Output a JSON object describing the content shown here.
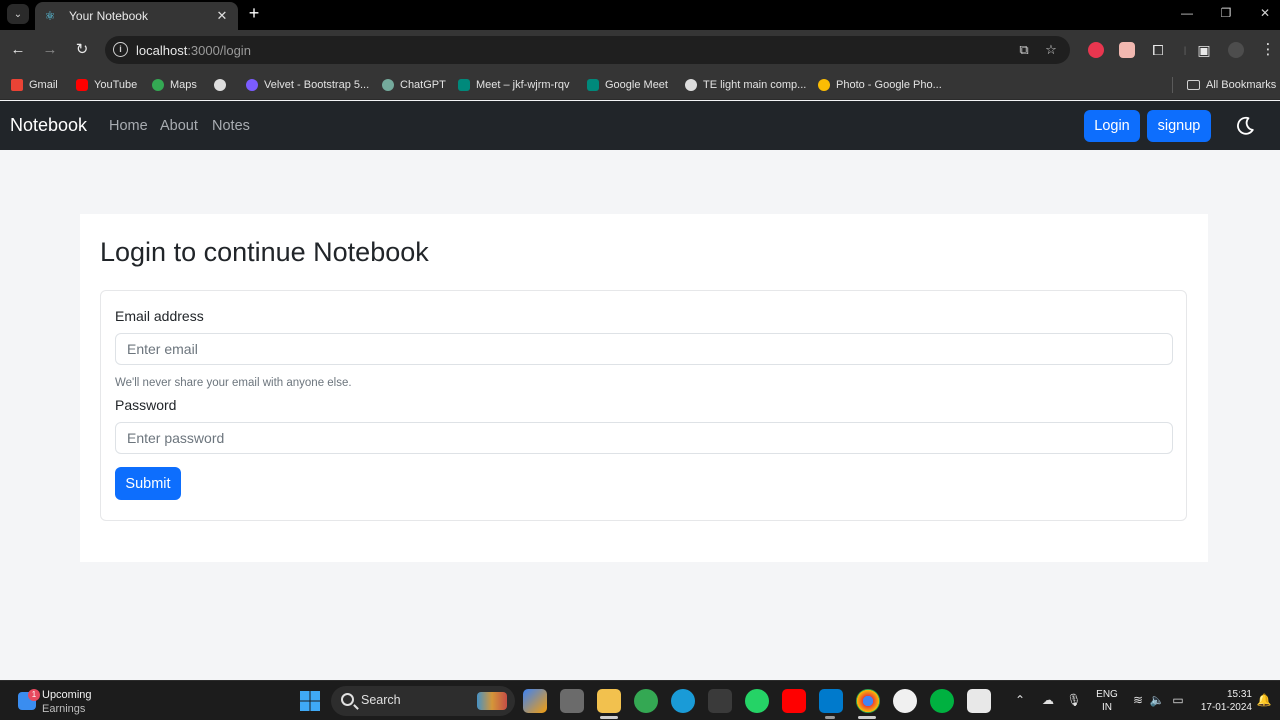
{
  "browser": {
    "tab": {
      "title": "Your Notebook",
      "favicon": "react-icon"
    },
    "url": {
      "host": "localhost",
      "path": ":3000/login"
    },
    "bookmarks": [
      {
        "label": "Gmail",
        "icon": "gmail-icon",
        "color": "#ea4335"
      },
      {
        "label": "YouTube",
        "icon": "youtube-icon",
        "color": "#ff0000"
      },
      {
        "label": "Maps",
        "icon": "maps-icon",
        "color": "#34a853"
      },
      {
        "label": "",
        "icon": "globe-icon",
        "color": "#dddddd"
      },
      {
        "label": "Velvet - Bootstrap 5...",
        "icon": "velvet-icon",
        "color": "#7b5cff"
      },
      {
        "label": "ChatGPT",
        "icon": "chatgpt-icon",
        "color": "#74aa9c"
      },
      {
        "label": "Meet – jkf-wjrm-rqv",
        "icon": "meet-icon",
        "color": "#00897b"
      },
      {
        "label": "Google Meet",
        "icon": "meet-icon",
        "color": "#00897b"
      },
      {
        "label": "TE light main comp...",
        "icon": "globe-icon",
        "color": "#dddddd"
      },
      {
        "label": "Photo - Google Pho...",
        "icon": "photos-icon",
        "color": "#fbbc04"
      }
    ],
    "all_bookmarks": "All Bookmarks"
  },
  "navbar": {
    "brand": "Notebook",
    "links": [
      "Home",
      "About",
      "Notes"
    ],
    "login_label": "Login",
    "signup_label": "signup",
    "theme_icon": "moon-icon"
  },
  "page": {
    "title": "Login to continue Notebook",
    "email_label": "Email address",
    "email_placeholder": "Enter email",
    "email_help": "We'll never share your email with anyone else.",
    "password_label": "Password",
    "password_placeholder": "Enter password",
    "submit_label": "Submit"
  },
  "taskbar": {
    "weather_title": "Upcoming",
    "weather_subtitle": "Earnings",
    "weather_badge": "1",
    "search_label": "Search",
    "lang_line1": "ENG",
    "lang_line2": "IN",
    "time": "15:31",
    "date": "17-01-2024"
  },
  "colors": {
    "primary": "#0d6efd",
    "navbar_bg": "#212529",
    "page_bg": "#f4f5f7"
  }
}
